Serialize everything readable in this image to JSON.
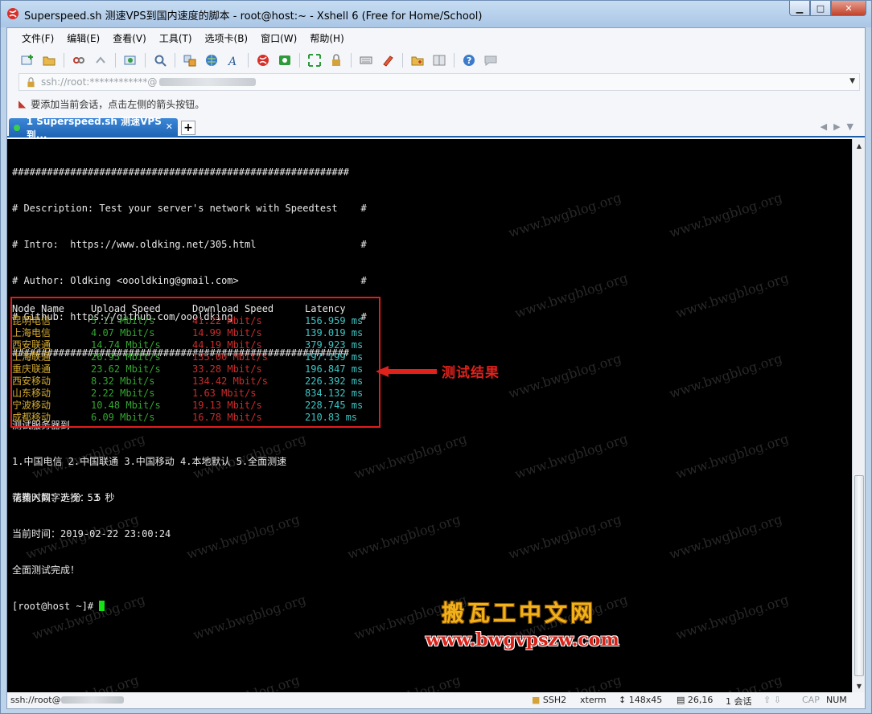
{
  "window": {
    "title": "Superspeed.sh 测速VPS到国内速度的脚本 - root@host:~ - Xshell 6 (Free for Home/School)",
    "buttons": {
      "minimize": "▁",
      "maximize": "□",
      "close": "✕"
    }
  },
  "menu": [
    "文件(F)",
    "编辑(E)",
    "查看(V)",
    "工具(T)",
    "选项卡(B)",
    "窗口(W)",
    "帮助(H)"
  ],
  "address": {
    "prefix": "ssh://root:************@"
  },
  "hint": {
    "text": "要添加当前会话，点击左侧的箭头按钮。"
  },
  "tab": {
    "label": "1 Superspeed.sh 测速VPS到...",
    "close": "✕",
    "add": "+"
  },
  "terminal": {
    "header": [
      "##########################################################",
      "# Description: Test your server's network with Speedtest    #",
      "# Intro:  https://www.oldking.net/305.html                  #",
      "# Author: Oldking <oooldking@gmail.com>                     #",
      "# Github: https://github.com/oooldking                      #",
      "##########################################################"
    ],
    "prompt_title": "测试服务器到",
    "options": "1.中国电信 2.中国联通 3.中国移动 4.本地默认 5.全面测速",
    "input_line": "请输入数字选择： 5",
    "columns": [
      "Node Name",
      "Upload Speed",
      "Download Speed",
      "Latency"
    ],
    "rows": [
      {
        "node": "昆明电信",
        "upload": "5.11 Mbit/s",
        "download": "41.22 Mbit/s",
        "latency": "156.959 ms"
      },
      {
        "node": "上海电信",
        "upload": "4.07 Mbit/s",
        "download": "14.99 Mbit/s",
        "latency": "139.019 ms"
      },
      {
        "node": "西安联通",
        "upload": "14.74 Mbit/s",
        "download": "44.19 Mbit/s",
        "latency": "379.923 ms"
      },
      {
        "node": "上海联通",
        "upload": "26.95 Mbit/s",
        "download": "135.00 Mbit/s",
        "latency": "197.199 ms"
      },
      {
        "node": "重庆联通",
        "upload": "23.62 Mbit/s",
        "download": "33.28 Mbit/s",
        "latency": "196.847 ms"
      },
      {
        "node": "西安移动",
        "upload": "8.32 Mbit/s",
        "download": "134.42 Mbit/s",
        "latency": "226.392 ms"
      },
      {
        "node": "山东移动",
        "upload": "2.22 Mbit/s",
        "download": "1.63 Mbit/s",
        "latency": "834.132 ms"
      },
      {
        "node": "宁波移动",
        "upload": "10.48 Mbit/s",
        "download": "19.13 Mbit/s",
        "latency": "228.745 ms"
      },
      {
        "node": "成都移动",
        "upload": "6.09 Mbit/s",
        "download": "16.78 Mbit/s",
        "latency": "210.83 ms"
      }
    ],
    "elapsed": "花费时间：3 分 53 秒",
    "current_time": "当前时间：2019-02-22 23:00:24",
    "done": "全面测试完成！",
    "shell_prompt": "[root@host ~]# "
  },
  "annotation": {
    "label": "测试结果"
  },
  "watermark": "www.bwgblog.org",
  "brand": {
    "name": "搬瓦工中文网",
    "url": "www.bwgvpszw.com"
  },
  "status": {
    "session": "ssh://root@",
    "protocol": "SSH2",
    "term": "xterm",
    "size": "148x45",
    "cursor": "26,16",
    "sessions": "1 会话",
    "caps": "CAP",
    "num": "NUM"
  },
  "colors": {
    "node": "#d6ac32",
    "upload": "#33a62f",
    "download": "#cc2b2b",
    "latency": "#3cc4c4",
    "highlight": "#e21d1d",
    "tab": "#1e63b3"
  },
  "icons": [
    "new-session-icon",
    "open-folder-icon",
    "disconnect-icon",
    "reconnect-icon",
    "properties-icon",
    "find-icon",
    "transfer-icon",
    "globe-icon",
    "font-icon",
    "xftp-icon",
    "xmanager-icon",
    "fullscreen-icon",
    "lock-icon",
    "keyboard-icon",
    "highlight-icon",
    "new-tab-icon",
    "layout-icon",
    "help-icon",
    "chat-icon"
  ]
}
